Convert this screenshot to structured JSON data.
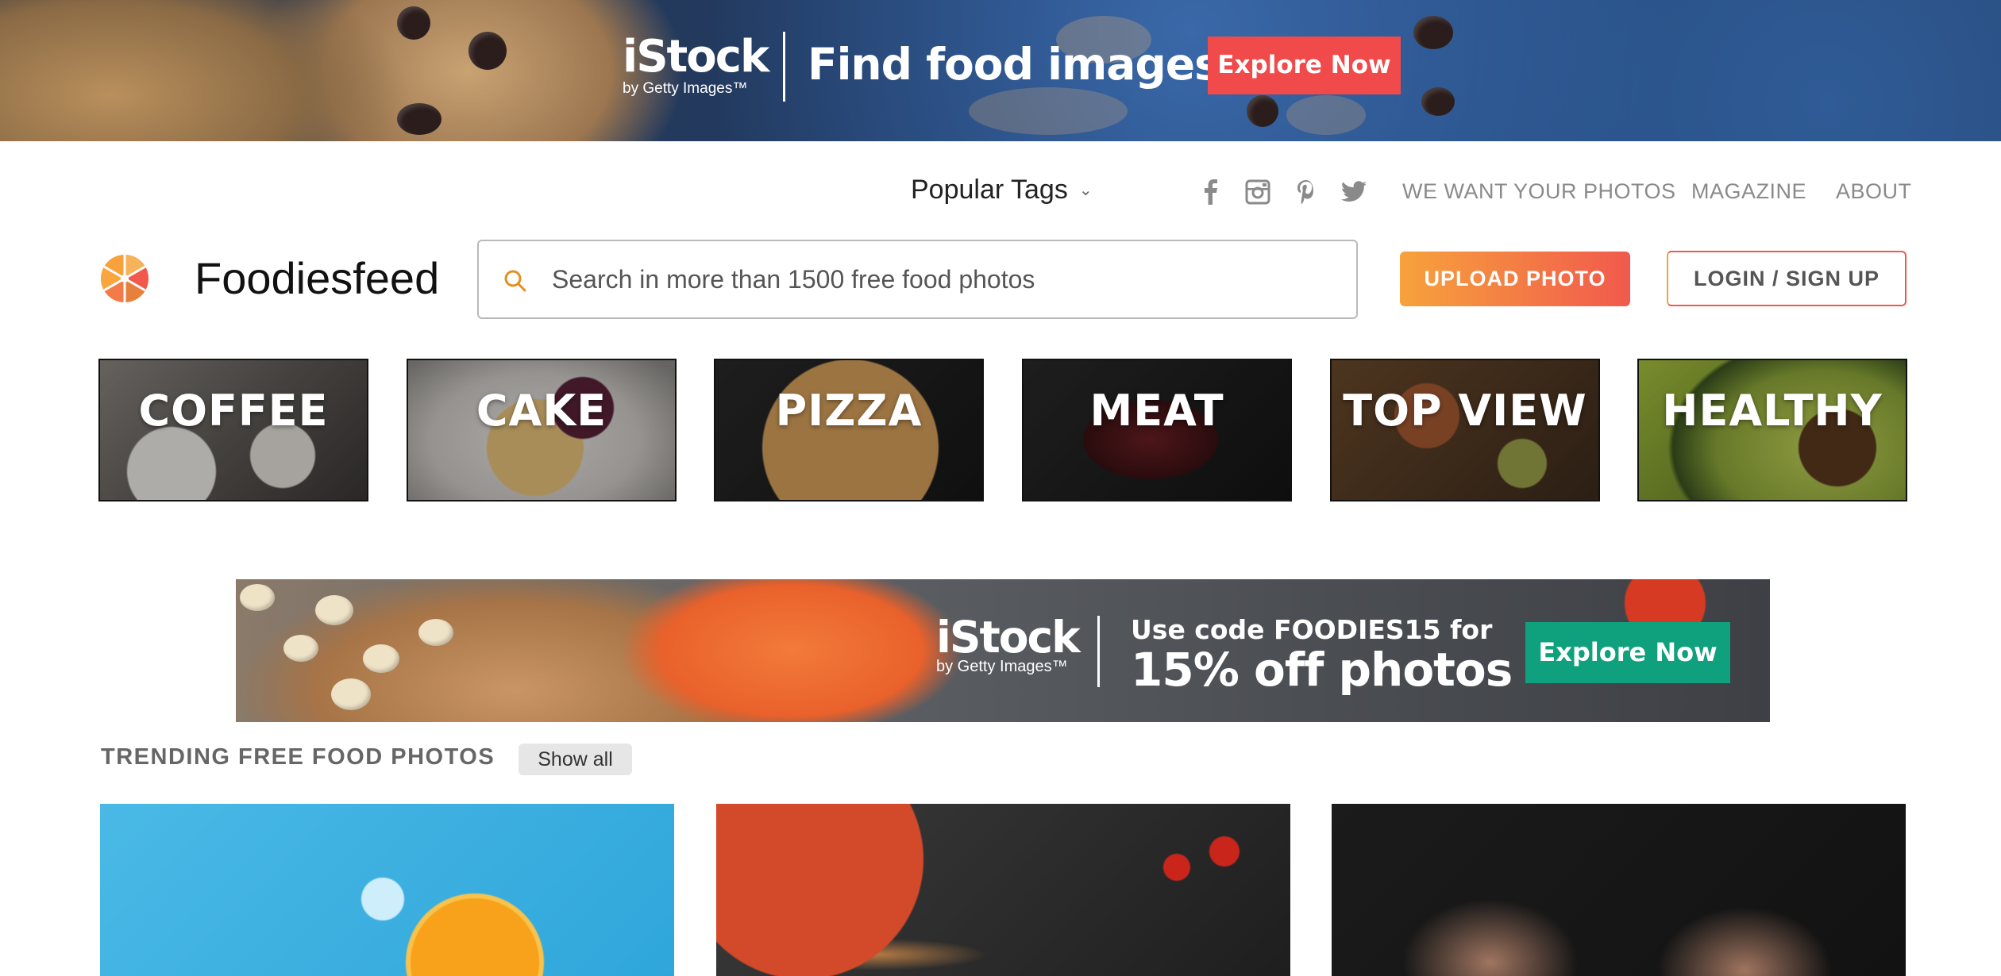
{
  "top_banner": {
    "logo_brand": "iStock",
    "logo_sub": "by Getty Images™",
    "headline": "Find food images",
    "cta_label": "Explore Now",
    "cta_color": "#f04a4a"
  },
  "nav": {
    "popular_tags_label": "Popular Tags",
    "social_icons": [
      "facebook-icon",
      "instagram-icon",
      "pinterest-icon",
      "twitter-icon"
    ],
    "links": [
      "WE WANT YOUR PHOTOS",
      "MAGAZINE",
      "ABOUT"
    ]
  },
  "header": {
    "site_name": "Foodiesfeed",
    "search_placeholder": "Search in more than 1500 free food photos",
    "upload_label": "UPLOAD PHOTO",
    "login_label": "LOGIN / SIGN UP",
    "accent_start": "#f7a23c",
    "accent_end": "#f1594d"
  },
  "categories": [
    "COFFEE",
    "CAKE",
    "PIZZA",
    "MEAT",
    "TOP VIEW",
    "HEALTHY"
  ],
  "promo_banner": {
    "logo_brand": "iStock",
    "logo_sub": "by Getty Images™",
    "line1": "Use code FOODIES15 for",
    "line2": "15% off photos",
    "cta_label": "Explore Now",
    "cta_color": "#0fa07e"
  },
  "trending": {
    "title": "TRENDING FREE FOOD PHOTOS",
    "show_all_label": "Show all"
  }
}
